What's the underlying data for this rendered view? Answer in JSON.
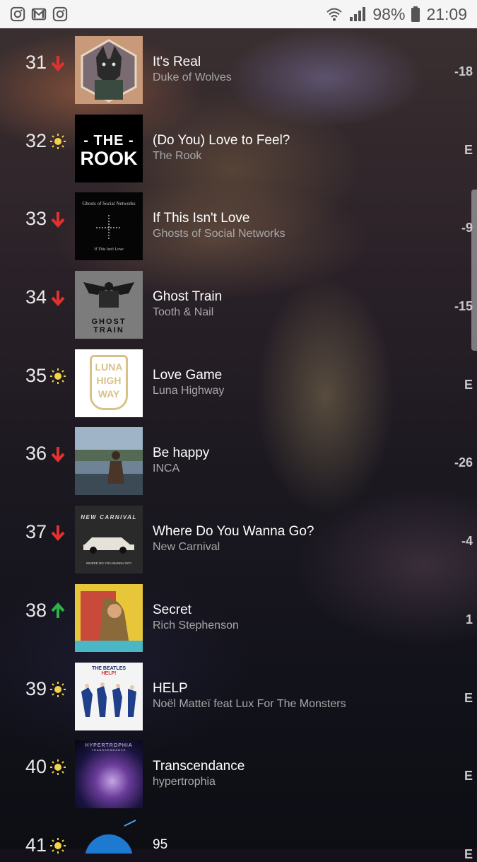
{
  "status_bar": {
    "battery": "98%",
    "time": "21:09",
    "left_icons": [
      "instagram-icon",
      "gmail-icon",
      "instagram-icon"
    ]
  },
  "colors": {
    "down": "#e0322e",
    "up": "#2bb34a",
    "new": "#f2d34a"
  },
  "chart": [
    {
      "rank": "31",
      "move": "down",
      "title": "It's Real",
      "artist": "Duke of Wolves",
      "delta": "-18"
    },
    {
      "rank": "32",
      "move": "new",
      "title": "(Do You) Love to Feel?",
      "artist": "The Rook",
      "delta": "E"
    },
    {
      "rank": "33",
      "move": "down",
      "title": "If This Isn't Love",
      "artist": "Ghosts of Social Networks",
      "delta": "-9"
    },
    {
      "rank": "34",
      "move": "down",
      "title": "Ghost Train",
      "artist": "Tooth & Nail",
      "delta": "-15"
    },
    {
      "rank": "35",
      "move": "new",
      "title": "Love Game",
      "artist": "Luna Highway",
      "delta": "E"
    },
    {
      "rank": "36",
      "move": "down",
      "title": "Be happy",
      "artist": "INCA",
      "delta": "-26"
    },
    {
      "rank": "37",
      "move": "down",
      "title": "Where Do You Wanna Go?",
      "artist": "New Carnival",
      "delta": "-4"
    },
    {
      "rank": "38",
      "move": "up",
      "title": "Secret",
      "artist": "Rich Stephenson",
      "delta": "1"
    },
    {
      "rank": "39",
      "move": "new",
      "title": "HELP",
      "artist": "Noël Matteï feat Lux For The Monsters",
      "delta": "E"
    },
    {
      "rank": "40",
      "move": "new",
      "title": "Transcendance",
      "artist": "hypertrophia",
      "delta": "E"
    },
    {
      "rank": "41",
      "move": "new",
      "title": "95",
      "artist": "",
      "delta": "E"
    }
  ],
  "art": {
    "rook": {
      "top": "- THE -",
      "bottom": "ROOK"
    },
    "ghosts": {
      "top": "Ghosts of Social Networks",
      "bottom": "If This Isn't Love"
    },
    "tooth": {
      "banner": "GHOST TRAIN"
    },
    "luna": {
      "l1": "LUNA",
      "l2": "HIGH",
      "l3": "WAY"
    },
    "carnival": {
      "top": "NEW CARNIVAL",
      "bottom": "WHERE DO YOU WANNA GO?"
    },
    "help": {
      "top": "THE BEATLES",
      "l2": "HELP!"
    },
    "hyper": {
      "top": "HYPERTROPHIA",
      "l2": "TRANSCENDANCE"
    }
  }
}
